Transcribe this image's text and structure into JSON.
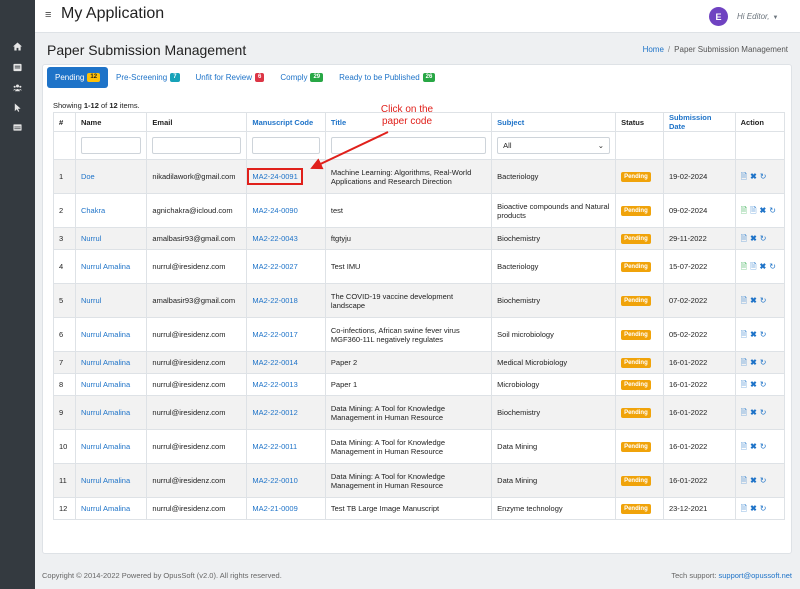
{
  "app": {
    "title": "My Application",
    "user_initial": "E",
    "greeting": "Hi Editor,"
  },
  "page": {
    "title": "Paper Submission Management"
  },
  "breadcrumb": {
    "home": "Home",
    "current": "Paper Submission Management"
  },
  "tabs": [
    {
      "label": "Pending",
      "count": "12"
    },
    {
      "label": "Pre-Screening",
      "count": "7"
    },
    {
      "label": "Unfit for Review",
      "count": "6"
    },
    {
      "label": "Comply",
      "count": "29"
    },
    {
      "label": "Ready to be Published",
      "count": "26"
    }
  ],
  "summary": {
    "prefix": "Showing ",
    "range": "1-12",
    "of": " of ",
    "total": "12",
    "suffix": " items."
  },
  "table": {
    "headers": [
      "#",
      "Name",
      "Email",
      "Manuscript Code",
      "Title",
      "Subject",
      "Status",
      "Submission Date",
      "Action"
    ],
    "subject_filter": "All",
    "rows": [
      {
        "no": "1",
        "name": "Doe",
        "email": "nikadilawork@gmail.com",
        "code": "MA2-24-0091",
        "title": "Machine Learning: Algorithms, Real-World Applications and Research Direction",
        "subject": "Bacteriology",
        "status": "Pending",
        "date": "19-02-2024"
      },
      {
        "no": "2",
        "name": "Chakra",
        "email": "agnichakra@icloud.com",
        "code": "MA2-24-0090",
        "title": "test",
        "subject": "Bioactive compounds and Natural products",
        "status": "Pending",
        "date": "09-02-2024"
      },
      {
        "no": "3",
        "name": "Nurrul",
        "email": "amalbasir93@gmail.com",
        "code": "MA2-22-0043",
        "title": "ftgtyju",
        "subject": "Biochemistry",
        "status": "Pending",
        "date": "29-11-2022"
      },
      {
        "no": "4",
        "name": "Nurrul Amalina",
        "email": "nurrul@iresidenz.com",
        "code": "MA2-22-0027",
        "title": "Test IMU",
        "subject": "Bacteriology",
        "status": "Pending",
        "date": "15-07-2022"
      },
      {
        "no": "5",
        "name": "Nurrul",
        "email": "amalbasir93@gmail.com",
        "code": "MA2-22-0018",
        "title": "The COVID-19 vaccine development landscape",
        "subject": "Biochemistry",
        "status": "Pending",
        "date": "07-02-2022"
      },
      {
        "no": "6",
        "name": "Nurrul Amalina",
        "email": "nurrul@iresidenz.com",
        "code": "MA2-22-0017",
        "title": "Co-infections, African swine fever virus MGF360-11L negatively regulates",
        "subject": "Soil microbiology",
        "status": "Pending",
        "date": "05-02-2022"
      },
      {
        "no": "7",
        "name": "Nurrul Amalina",
        "email": "nurrul@iresidenz.com",
        "code": "MA2-22-0014",
        "title": "Paper 2",
        "subject": "Medical Microbiology",
        "status": "Pending",
        "date": "16-01-2022"
      },
      {
        "no": "8",
        "name": "Nurrul Amalina",
        "email": "nurrul@iresidenz.com",
        "code": "MA2-22-0013",
        "title": "Paper 1",
        "subject": "Microbiology",
        "status": "Pending",
        "date": "16-01-2022"
      },
      {
        "no": "9",
        "name": "Nurrul Amalina",
        "email": "nurrul@iresidenz.com",
        "code": "MA2-22-0012",
        "title": "Data Mining: A Tool for Knowledge Management in Human Resource",
        "subject": "Biochemistry",
        "status": "Pending",
        "date": "16-01-2022"
      },
      {
        "no": "10",
        "name": "Nurrul Amalina",
        "email": "nurrul@iresidenz.com",
        "code": "MA2-22-0011",
        "title": "Data Mining: A Tool for Knowledge Management in Human Resource",
        "subject": "Data Mining",
        "status": "Pending",
        "date": "16-01-2022"
      },
      {
        "no": "11",
        "name": "Nurrul Amalina",
        "email": "nurrul@iresidenz.com",
        "code": "MA2-22-0010",
        "title": "Data Mining: A Tool for Knowledge Management in Human Resource",
        "subject": "Data Mining",
        "status": "Pending",
        "date": "16-01-2022"
      },
      {
        "no": "12",
        "name": "Nurrul Amalina",
        "email": "nurrul@iresidenz.com",
        "code": "MA2-21-0009",
        "title": "Test TB Large Image Manuscript",
        "subject": "Enzyme technology",
        "status": "Pending",
        "date": "23-12-2021"
      }
    ]
  },
  "annotation": {
    "text": "Click on the paper code"
  },
  "footer": {
    "copyright": "Copyright © 2014-2022 Powered by OpusSoft (v2.0). All rights reserved.",
    "support_label": "Tech support: ",
    "support_email": "support@opussoft.net"
  },
  "colors": {
    "sidebar": "#343a40",
    "accent": "#1e73c8",
    "status_pending": "#f0a30a",
    "annotation": "#e0201b"
  },
  "icons": [
    "menu-icon",
    "home-icon",
    "list-icon",
    "users-icon",
    "cursor-icon",
    "table-icon",
    "document-icon",
    "delete-icon",
    "refresh-icon"
  ]
}
